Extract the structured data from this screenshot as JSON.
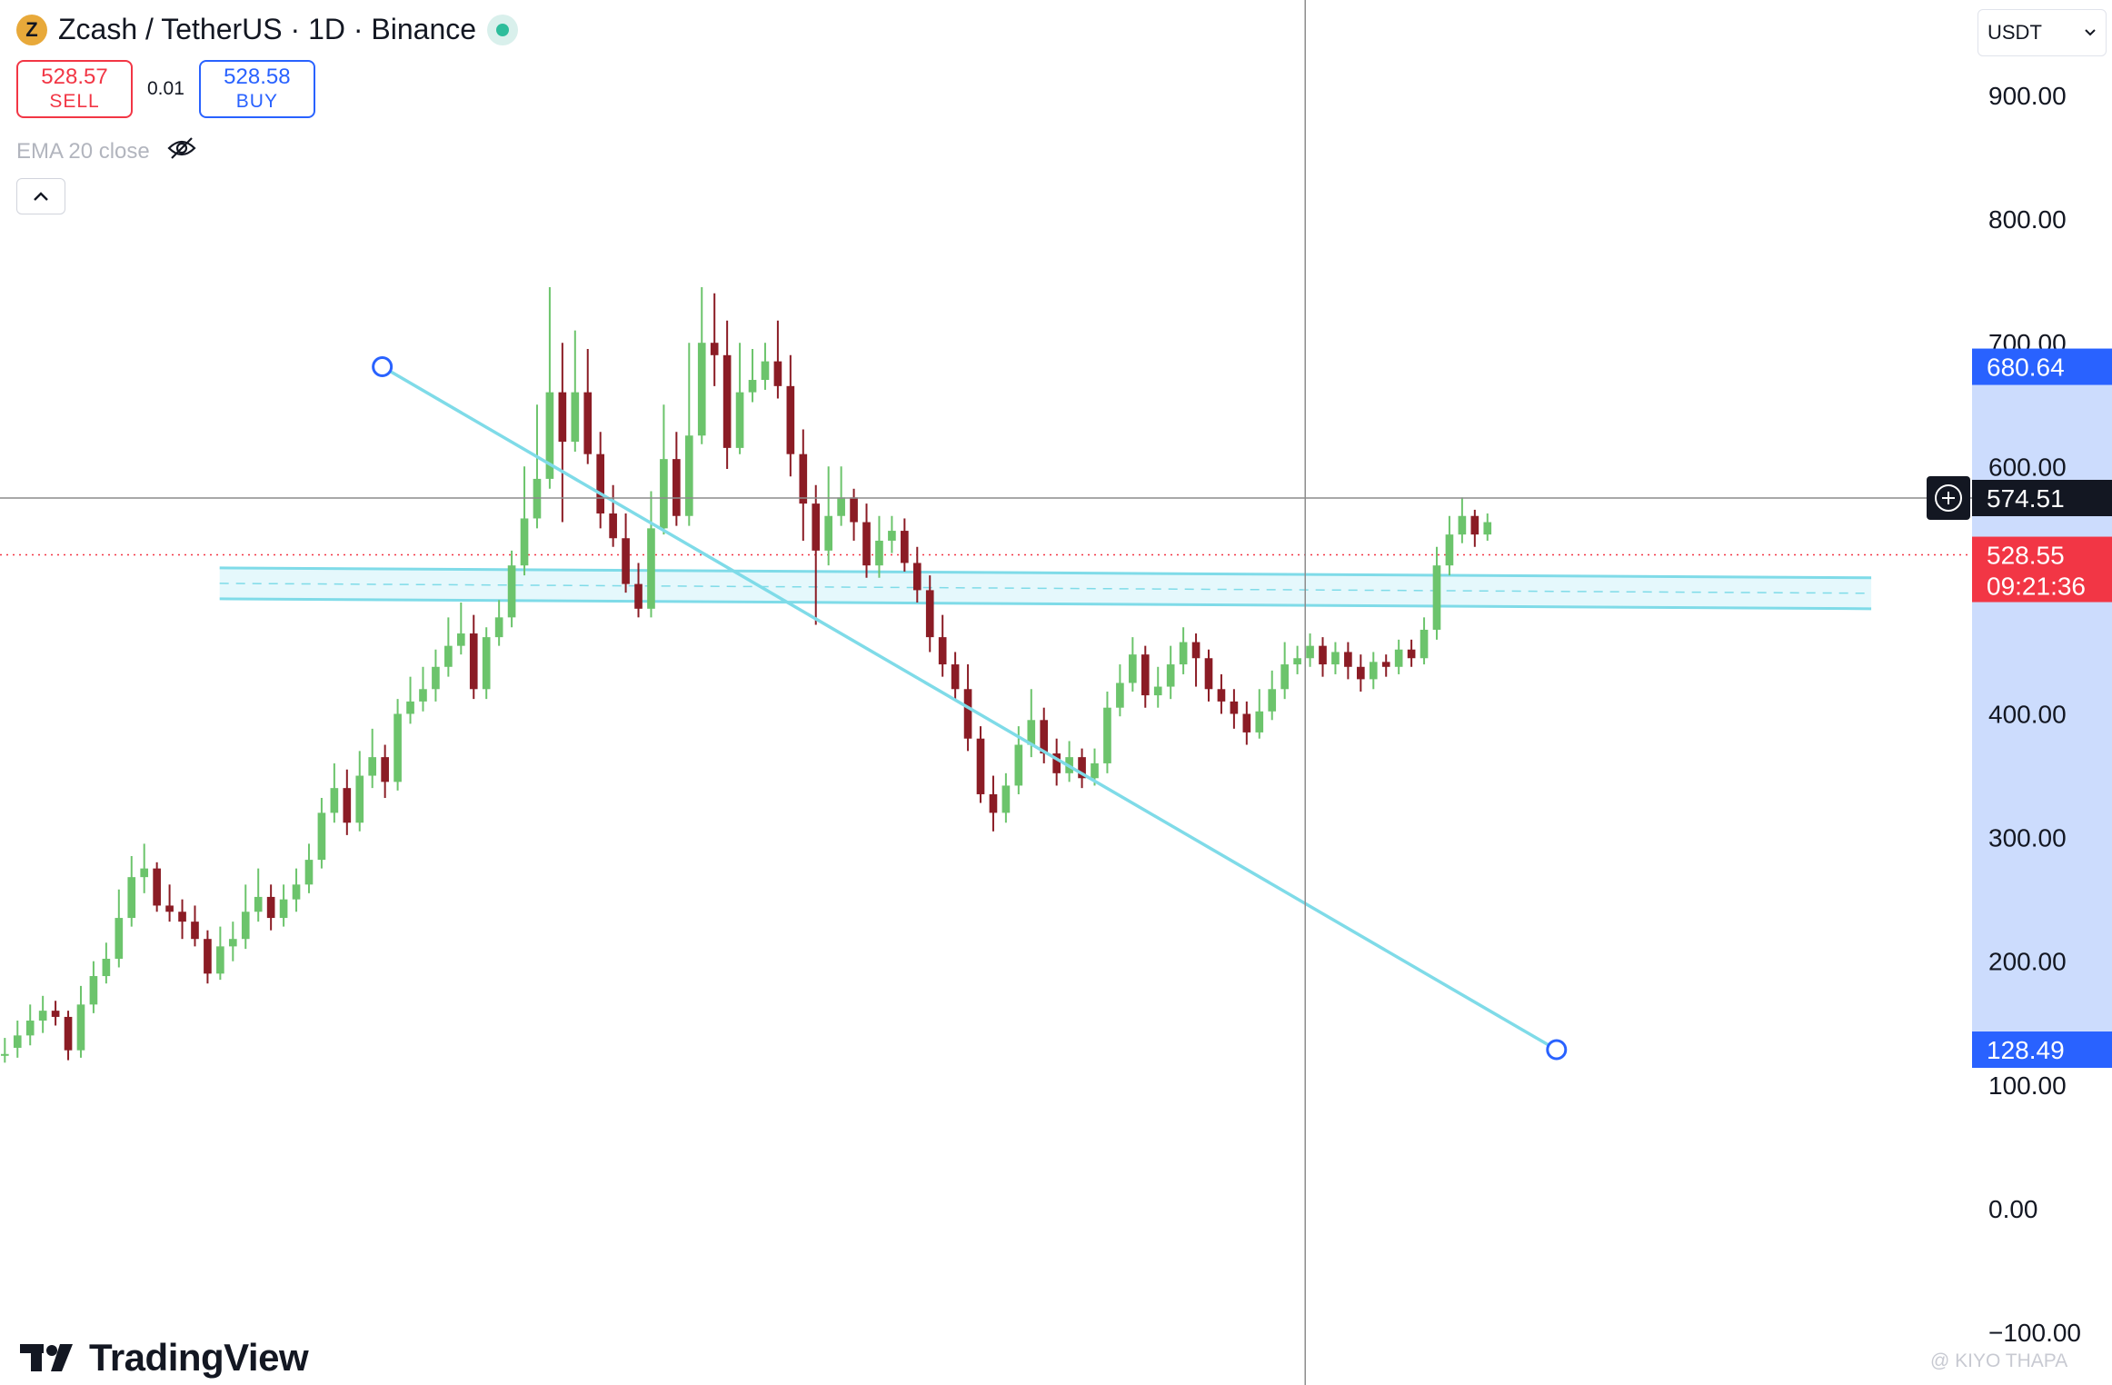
{
  "header": {
    "title": "Zcash / TetherUS · 1D · Binance",
    "coin_symbol": "Z"
  },
  "trade": {
    "sell_price": "528.57",
    "sell_label": "SELL",
    "spread": "0.01",
    "buy_price": "528.58",
    "buy_label": "BUY"
  },
  "indicator": {
    "label": "EMA 20 close",
    "visibility_icon": "eye-off-icon"
  },
  "currency_select": {
    "value": "USDT"
  },
  "branding": {
    "logo_text": "TradingView",
    "watermark": "@ KIYO THAPA"
  },
  "colors": {
    "up": "#6cc46c",
    "down": "#8b1c25",
    "trendline": "#7fdbe8",
    "zone_fill": "#dff6fb",
    "highlight": "#ccdcfd",
    "marker_blue": "#2962ff",
    "price_red": "#f23645",
    "crosshair": "#8c8c8c"
  },
  "chart_data": {
    "type": "candlestick",
    "ylim": [
      -100,
      900
    ],
    "y_ticks": [
      "900.00",
      "800.00",
      "700.00",
      "600.00",
      "500.00",
      "400.00",
      "300.00",
      "200.00",
      "100.00",
      "0.00",
      "−100.00"
    ],
    "y_tick_values": [
      900,
      800,
      700,
      600,
      500,
      400,
      300,
      200,
      100,
      0,
      -100
    ],
    "grid": false,
    "candles": [
      [
        0.0,
        125,
        125,
        118,
        138
      ],
      [
        0.006,
        130,
        140,
        122,
        152
      ],
      [
        0.012,
        140,
        152,
        132,
        165
      ],
      [
        0.018,
        152,
        160,
        142,
        172
      ],
      [
        0.024,
        160,
        155,
        148,
        168
      ],
      [
        0.03,
        155,
        128,
        120,
        160
      ],
      [
        0.036,
        128,
        165,
        122,
        180
      ],
      [
        0.042,
        165,
        188,
        158,
        200
      ],
      [
        0.048,
        188,
        202,
        182,
        215
      ],
      [
        0.054,
        202,
        235,
        195,
        258
      ],
      [
        0.06,
        235,
        268,
        228,
        285
      ],
      [
        0.066,
        268,
        275,
        255,
        295
      ],
      [
        0.072,
        275,
        245,
        240,
        280
      ],
      [
        0.078,
        245,
        240,
        232,
        262
      ],
      [
        0.084,
        240,
        232,
        218,
        250
      ],
      [
        0.09,
        232,
        218,
        212,
        245
      ],
      [
        0.096,
        218,
        190,
        182,
        225
      ],
      [
        0.102,
        190,
        212,
        185,
        228
      ],
      [
        0.108,
        212,
        218,
        200,
        232
      ],
      [
        0.114,
        218,
        240,
        210,
        262
      ],
      [
        0.12,
        240,
        252,
        232,
        275
      ],
      [
        0.126,
        252,
        235,
        225,
        262
      ],
      [
        0.132,
        235,
        250,
        228,
        262
      ],
      [
        0.138,
        250,
        262,
        240,
        275
      ],
      [
        0.144,
        262,
        282,
        255,
        295
      ],
      [
        0.15,
        282,
        320,
        275,
        332
      ],
      [
        0.156,
        320,
        340,
        312,
        360
      ],
      [
        0.162,
        340,
        312,
        302,
        355
      ],
      [
        0.168,
        312,
        350,
        305,
        370
      ],
      [
        0.174,
        350,
        365,
        340,
        388
      ],
      [
        0.18,
        365,
        345,
        332,
        375
      ],
      [
        0.186,
        345,
        400,
        338,
        412
      ],
      [
        0.192,
        400,
        410,
        392,
        430
      ],
      [
        0.198,
        410,
        420,
        402,
        438
      ],
      [
        0.204,
        420,
        438,
        410,
        452
      ],
      [
        0.21,
        438,
        455,
        430,
        478
      ],
      [
        0.216,
        455,
        465,
        448,
        490
      ],
      [
        0.222,
        465,
        420,
        412,
        480
      ],
      [
        0.228,
        420,
        462,
        412,
        470
      ],
      [
        0.234,
        462,
        478,
        455,
        492
      ],
      [
        0.24,
        478,
        520,
        470,
        532
      ],
      [
        0.246,
        520,
        558,
        512,
        600
      ],
      [
        0.252,
        558,
        590,
        550,
        650
      ],
      [
        0.258,
        590,
        660,
        582,
        745
      ],
      [
        0.264,
        660,
        620,
        555,
        700
      ],
      [
        0.27,
        620,
        660,
        612,
        710
      ],
      [
        0.276,
        660,
        610,
        602,
        695
      ],
      [
        0.282,
        610,
        562,
        550,
        628
      ],
      [
        0.288,
        562,
        542,
        535,
        585
      ],
      [
        0.294,
        542,
        505,
        498,
        562
      ],
      [
        0.3,
        505,
        485,
        478,
        522
      ],
      [
        0.306,
        485,
        550,
        478,
        580
      ],
      [
        0.312,
        550,
        606,
        545,
        650
      ],
      [
        0.318,
        606,
        560,
        552,
        628
      ],
      [
        0.324,
        560,
        625,
        552,
        700
      ],
      [
        0.33,
        625,
        700,
        618,
        745
      ],
      [
        0.336,
        700,
        690,
        665,
        740
      ],
      [
        0.342,
        690,
        615,
        598,
        718
      ],
      [
        0.348,
        615,
        660,
        610,
        700
      ],
      [
        0.354,
        660,
        670,
        652,
        695
      ],
      [
        0.36,
        670,
        685,
        662,
        700
      ],
      [
        0.366,
        685,
        665,
        655,
        718
      ],
      [
        0.372,
        665,
        610,
        592,
        690
      ],
      [
        0.378,
        610,
        570,
        540,
        630
      ],
      [
        0.384,
        570,
        532,
        472,
        585
      ],
      [
        0.39,
        532,
        560,
        520,
        600
      ],
      [
        0.396,
        560,
        575,
        552,
        600
      ],
      [
        0.402,
        575,
        555,
        540,
        582
      ],
      [
        0.408,
        555,
        520,
        510,
        570
      ],
      [
        0.414,
        520,
        540,
        510,
        560
      ],
      [
        0.42,
        540,
        548,
        530,
        560
      ],
      [
        0.426,
        548,
        522,
        515,
        558
      ],
      [
        0.432,
        522,
        500,
        490,
        535
      ],
      [
        0.438,
        500,
        462,
        450,
        512
      ],
      [
        0.444,
        462,
        440,
        430,
        480
      ],
      [
        0.45,
        440,
        420,
        412,
        450
      ],
      [
        0.456,
        420,
        380,
        370,
        440
      ],
      [
        0.462,
        380,
        335,
        328,
        390
      ],
      [
        0.468,
        335,
        320,
        305,
        350
      ],
      [
        0.474,
        320,
        342,
        312,
        352
      ],
      [
        0.48,
        342,
        375,
        335,
        390
      ],
      [
        0.486,
        375,
        395,
        365,
        420
      ],
      [
        0.492,
        395,
        368,
        360,
        405
      ],
      [
        0.498,
        368,
        352,
        342,
        380
      ],
      [
        0.504,
        352,
        365,
        345,
        378
      ],
      [
        0.51,
        365,
        348,
        340,
        372
      ],
      [
        0.516,
        348,
        360,
        342,
        372
      ],
      [
        0.522,
        360,
        405,
        352,
        418
      ],
      [
        0.528,
        405,
        425,
        398,
        440
      ],
      [
        0.534,
        425,
        448,
        418,
        462
      ],
      [
        0.54,
        448,
        415,
        405,
        455
      ],
      [
        0.546,
        415,
        422,
        405,
        438
      ],
      [
        0.552,
        422,
        440,
        412,
        455
      ],
      [
        0.558,
        440,
        458,
        432,
        470
      ],
      [
        0.564,
        458,
        445,
        422,
        465
      ],
      [
        0.57,
        445,
        420,
        410,
        452
      ],
      [
        0.576,
        420,
        410,
        400,
        432
      ],
      [
        0.582,
        410,
        400,
        388,
        420
      ],
      [
        0.588,
        400,
        385,
        375,
        410
      ],
      [
        0.594,
        385,
        402,
        380,
        420
      ],
      [
        0.6,
        402,
        420,
        395,
        435
      ],
      [
        0.606,
        420,
        440,
        412,
        458
      ],
      [
        0.612,
        440,
        445,
        432,
        455
      ],
      [
        0.618,
        445,
        455,
        438,
        465
      ],
      [
        0.624,
        455,
        440,
        430,
        462
      ],
      [
        0.63,
        440,
        450,
        432,
        458
      ],
      [
        0.636,
        450,
        438,
        428,
        458
      ],
      [
        0.642,
        438,
        428,
        418,
        448
      ],
      [
        0.648,
        428,
        442,
        420,
        450
      ],
      [
        0.654,
        442,
        438,
        430,
        448
      ],
      [
        0.66,
        438,
        452,
        432,
        460
      ],
      [
        0.666,
        452,
        445,
        438,
        460
      ],
      [
        0.672,
        445,
        468,
        440,
        478
      ],
      [
        0.678,
        468,
        520,
        460,
        535
      ],
      [
        0.684,
        520,
        545,
        512,
        560
      ],
      [
        0.69,
        545,
        560,
        538,
        575
      ],
      [
        0.696,
        560,
        545,
        535,
        565
      ],
      [
        0.702,
        545,
        555,
        540,
        562
      ]
    ],
    "zone": {
      "x1": 0.104,
      "x2": 0.886,
      "top_left": 518,
      "top_right": 510,
      "bottom_left": 493,
      "bottom_right": 485
    },
    "trendline": {
      "x1": 0.181,
      "y1": 680.64,
      "x2": 0.737,
      "y2": 128.49
    },
    "crosshair": {
      "x": 0.618,
      "y": 574.51
    },
    "current_price": 528.55,
    "labels": {
      "trend_start": "680.64",
      "trend_end": "128.49",
      "crosshair": "574.51",
      "current": "528.55",
      "countdown": "09:21:36"
    }
  }
}
